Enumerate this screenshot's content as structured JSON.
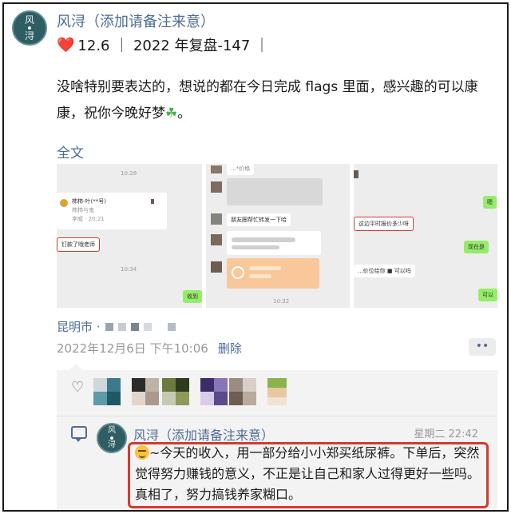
{
  "post": {
    "author": "风浔（添加请备注来意）",
    "avatar_top": "风",
    "avatar_bottom": "浔",
    "tagline_heart": "❤️",
    "tagline": "12.6 ｜ 2022 年复盘-147 ｜",
    "body": "没啥特别要表达的，想说的都在今日完成 flags 里面，感兴趣的可以康康，祝你今晚好梦",
    "body_end": "。",
    "full_text_link": "全文",
    "location": "昆明市 ·",
    "date": "2022年12月6日 下午10:06",
    "delete_label": "删除",
    "more_label": "••"
  },
  "screenshots": [
    {
      "time_top": "10:28",
      "name_line": "柿柿-叶(**号)",
      "sub_line": "柿柿与鬼",
      "tag_line": "李威 · 20:21",
      "highlight": "钉款了哦老师",
      "time_mid": "10:34",
      "reply": "收到"
    },
    {
      "top_text": "...*价格",
      "msg1": "朋友圈帮忙转发一下哈",
      "time_bottom": "10:32"
    },
    {
      "highlight": "这边平时报价多少呀",
      "msg2": "...价位给你 ■ 可以吗",
      "r1": "嗯",
      "r2": "现在是",
      "r3": "可以"
    }
  ],
  "comment": {
    "author": "风浔（添加请备注来意）",
    "time": "星期二 22:42",
    "text": "~今天的收入，用一部分给小小郑买纸尿裤。下单后，突然觉得努力赚钱的意义，不正是让自己和家人过得更好一些吗。真相了，努力搞钱养家糊口。"
  },
  "colors": {
    "link": "#4e6c95",
    "highlight_border": "#d23b2f",
    "panel": "#f3f3f3",
    "avatar": "#2f5d64"
  },
  "icons": [
    "heart-icon",
    "clover-icon",
    "like-heart-icon",
    "comment-icon",
    "emoji-icon",
    "more-icon"
  ]
}
